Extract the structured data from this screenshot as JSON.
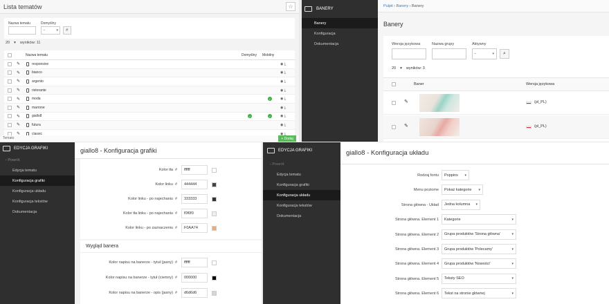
{
  "p1": {
    "title": "Lista tematów",
    "star": "☆",
    "filters": {
      "name_label": "Nazwa tematu",
      "default_label": "Domyślny",
      "default_value": "--"
    },
    "pager": {
      "per_page": "20",
      "results": "wyników: 11"
    },
    "headers": {
      "name": "Nazwa tematu",
      "default": "Domyślny",
      "mobile": "Mobilny"
    },
    "rows": [
      {
        "name": "responsive",
        "default": false,
        "mobile": false
      },
      {
        "name": "bianco",
        "default": false,
        "mobile": false
      },
      {
        "name": "argento",
        "default": false,
        "mobile": false
      },
      {
        "name": "ristorante",
        "default": false,
        "mobile": false
      },
      {
        "name": "moda",
        "default": false,
        "mobile": true
      },
      {
        "name": "marrone",
        "default": false,
        "mobile": false
      },
      {
        "name": "giallo8",
        "default": true,
        "mobile": true
      },
      {
        "name": "futura",
        "default": false,
        "mobile": false
      },
      {
        "name": "classic",
        "default": false,
        "mobile": false
      }
    ],
    "footer_left": "Temato",
    "footer_btn": "+ Dodaj"
  },
  "p2": {
    "brand": "BANERY",
    "nav": [
      "Banery",
      "Konfiguracja",
      "Dokumentacja"
    ],
    "crumb": {
      "a": "Pulpit",
      "b": "Banery",
      "c": "Banery"
    },
    "title": "Banery",
    "filters": {
      "lang": "Wersja językowa",
      "group": "Nazwa grupy",
      "active": "Aktywny",
      "active_value": "--"
    },
    "pager": {
      "per_page": "20",
      "results": "wyników: 3"
    },
    "headers": {
      "banner": "Baner",
      "lang": "Wersja językowa"
    },
    "rows": [
      {
        "lang": "(pl_PL)"
      },
      {
        "lang": "(pl_PL)"
      }
    ]
  },
  "p3": {
    "brand": "EDYCJA GRAFIKI",
    "back": "Powrót",
    "nav": [
      "Edycja tematu",
      "Konfiguracja grafiki",
      "Konfiguracja układu",
      "Konfiguracja tekstów",
      "Dokumentacja"
    ],
    "title": "giallo8 - Konfiguracja grafiki",
    "colors": [
      {
        "label": "Kolor tła",
        "hex": "ffffff",
        "swatch": "#ffffff"
      },
      {
        "label": "Kolor linku",
        "hex": "444444",
        "swatch": "#444444"
      },
      {
        "label": "Kolor linku - po najechaniu",
        "hex": "333333",
        "swatch": "#333333"
      },
      {
        "label": "Kolor tła linku - po najechaniu",
        "hex": "f0f0f0",
        "swatch": "#f0f0f0"
      },
      {
        "label": "Kolor linku - po zaznaczeniu",
        "hex": "F0AA74",
        "swatch": "#F0AA74"
      }
    ],
    "section": "Wygląd banera",
    "banner_colors": [
      {
        "label": "Kolor napisu na banerze - tytuł (jasny)",
        "hex": "ffffff",
        "swatch": "#ffffff"
      },
      {
        "label": "Kolor napisu na banerze - tytuł (ciemny)",
        "hex": "000000",
        "swatch": "#000000"
      },
      {
        "label": "Kolor napisu na banerze - opis (jasny)",
        "hex": "d6d6d6",
        "swatch": "#d6d6d6"
      }
    ]
  },
  "p4": {
    "brand": "EDYCJA GRAFIKI",
    "back": "Powrót",
    "nav": [
      "Edycja tematu",
      "Konfiguracja grafiki",
      "Konfiguracja układu",
      "Konfiguracja tekstów",
      "Dokumentacja"
    ],
    "title": "giallo8 - Konfiguracja układu",
    "fields": [
      {
        "label": "Rodzaj fontu",
        "value": "Poppins"
      },
      {
        "label": "Menu poziome",
        "value": "Pokaż kategorie"
      },
      {
        "label": "Strona główna - Układ",
        "value": "Jedna kolumna"
      },
      {
        "label": "Strona główna. Element 1",
        "value": "Kategorie"
      },
      {
        "label": "Strona główna. Element 2",
        "value": "Grupa produktów 'Strona główna'"
      },
      {
        "label": "Strona główna. Element 3",
        "value": "Grupa produktów 'Polecamy'"
      },
      {
        "label": "Strona główna. Element 4",
        "value": "Grupa produktów 'Nowości'"
      },
      {
        "label": "Strona główna. Element 5",
        "value": "Teksty SEO"
      },
      {
        "label": "Strona główna. Element 6",
        "value": "Tekst na stronie głównej"
      }
    ]
  }
}
